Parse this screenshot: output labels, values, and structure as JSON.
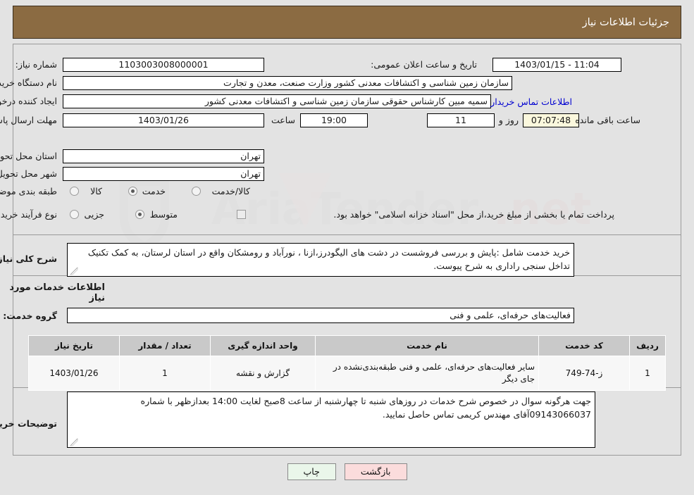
{
  "header": {
    "title": "جزئیات اطلاعات نیاز"
  },
  "fields": {
    "need_number_label": "شماره نیاز:",
    "need_number_value": "1103003008000001",
    "announce_datetime_label": "تاریخ و ساعت اعلان عمومی:",
    "announce_datetime_value": "11:04 - 1403/01/15",
    "buyer_org_label": "نام دستگاه خریدار:",
    "buyer_org_value": "سازمان زمین شناسی و اکتشافات معدنی کشور وزارت صنعت، معدن و تجارت",
    "creator_label": "ایجاد کننده درخواست:",
    "creator_value": "سمیه مبین کارشناس حقوقی سازمان زمین شناسی و اکتشافات معدنی کشور",
    "contact_link": "اطلاعات تماس خریدار",
    "deadline_label": "مهلت ارسال پاسخ: تا تاریخ:",
    "deadline_date": "1403/01/26",
    "hour_label": "ساعت",
    "deadline_time": "19:00",
    "days_remaining": "11",
    "days_and_label": "روز و",
    "time_remaining": "07:07:48",
    "time_remaining_label": "ساعت باقی مانده",
    "province_label": "استان محل تحویل:",
    "province_value": "تهران",
    "city_label": "شهر محل تحویل:",
    "city_value": "تهران",
    "category_label": "طبقه بندی موضوعی:",
    "category_options": [
      "کالا",
      "خدمت",
      "کالا/خدمت"
    ],
    "category_selected_index": 1,
    "process_label": "نوع فرآیند خرید :",
    "process_options": [
      "جزیی",
      "متوسط"
    ],
    "process_selected_index": 1,
    "treasury_checkbox_label": "پرداخت تمام یا بخشی از مبلغ خرید،از محل \"اسناد خزانه اسلامی\" خواهد بود.",
    "treasury_checked": false
  },
  "summary": {
    "label": "شرح کلی نیاز:",
    "text": "خرید خدمت شامل :پایش و بررسی فروشست در دشت های الیگودرز،ازنا ، نورآباد و رومشکان واقع در استان لرستان، به کمک تکنیک تداخل سنجی راداری به شرح پیوست."
  },
  "services": {
    "section_title": "اطلاعات خدمات مورد نیاز",
    "group_label": "گروه خدمت:",
    "group_value": "فعالیت‌های حرفه‌ای، علمی و فنی",
    "columns": [
      "ردیف",
      "کد خدمت",
      "نام خدمت",
      "واحد اندازه گیری",
      "تعداد / مقدار",
      "تاریخ نیاز"
    ],
    "rows": [
      {
        "row": "1",
        "code": "ز-74-749",
        "name": "سایر فعالیت‌های حرفه‌ای، علمی و فنی طبقه‌بندی‌نشده در جای دیگر",
        "unit": "گزارش و نقشه",
        "quantity": "1",
        "date": "1403/01/26"
      }
    ]
  },
  "buyer_notes": {
    "label": "توضیحات خریدار:",
    "text": "جهت هرگونه سوال در خصوص شرح خدمات در روزهای شنبه تا چهارشنبه از ساعت 8صبح لغایت 14:00 بعدازظهر با شماره 09143066037آقای مهندس کریمی تماس حاصل نمایید."
  },
  "footer": {
    "print_label": "چاپ",
    "back_label": "بازگشت"
  },
  "colors": {
    "header_bg": "#8b6b42",
    "page_bg": "#e3e3e3",
    "link": "#0000d0",
    "print_btn": "#eaf6ea",
    "back_btn": "#fbdcdc"
  }
}
